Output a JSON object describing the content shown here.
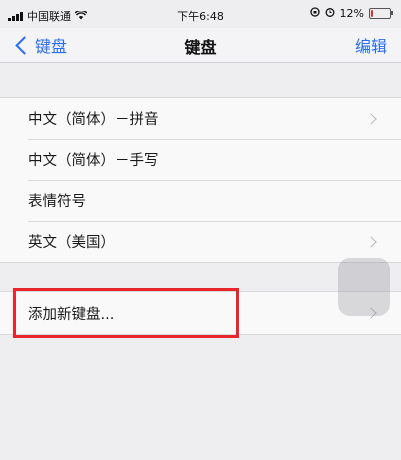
{
  "status_bar": {
    "carrier": "中国联通",
    "time": "下午6:48",
    "battery": "12%",
    "battery_level": 0.12,
    "battery_color": "#e0302a"
  },
  "nav": {
    "back_label": "键盘",
    "title": "键盘",
    "edit_label": "编辑"
  },
  "keyboards": [
    {
      "label": "中文（简体）－拼音",
      "chevron": true
    },
    {
      "label": "中文（简体）－手写",
      "chevron": false
    },
    {
      "label": "表情符号",
      "chevron": false
    },
    {
      "label": "英文（美国）",
      "chevron": true
    }
  ],
  "add_keyboard": {
    "label": "添加新键盘..."
  },
  "colors": {
    "accent": "#2a6df4",
    "highlight": "#e8262c",
    "background": "#eeeef0"
  }
}
